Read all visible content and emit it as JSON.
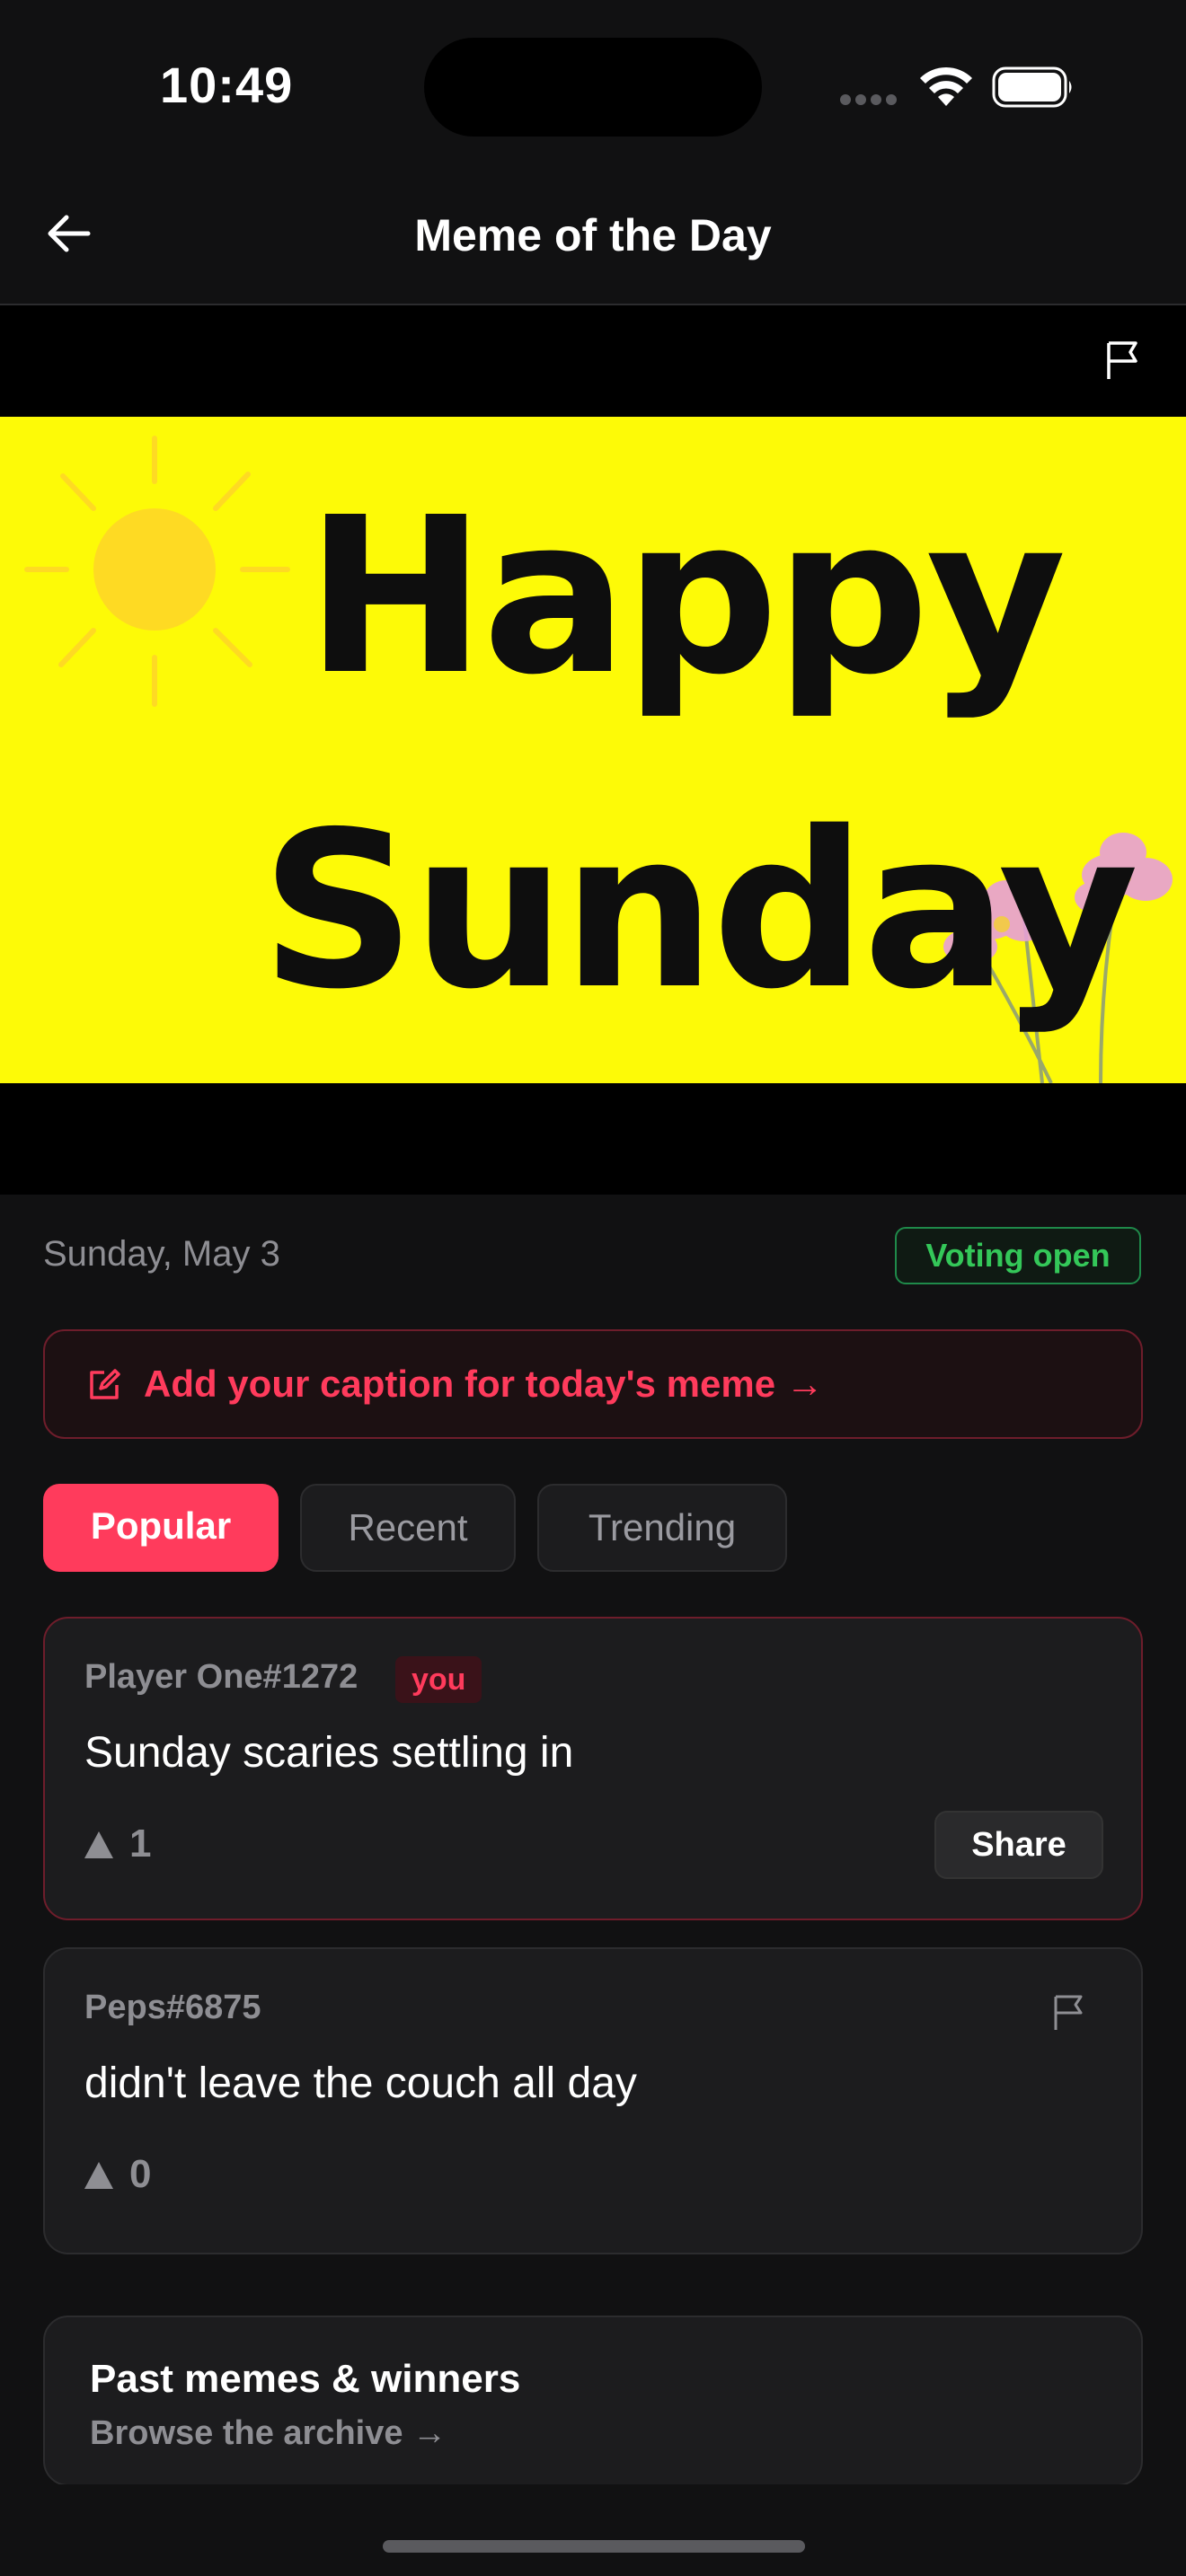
{
  "status_bar": {
    "time": "10:49"
  },
  "nav": {
    "title": "Meme of the Day",
    "back_icon": "arrow-left-icon"
  },
  "meme": {
    "line1": "Happy",
    "line2": "Sunday",
    "background_color": "#fdfa07",
    "flag_icon": "flag-icon"
  },
  "meta": {
    "date": "Sunday, May 3",
    "status": "Voting open",
    "status_color": "#34c759"
  },
  "cta": {
    "label": "Add your caption for today's meme →",
    "icon": "edit-icon",
    "accent": "#ff3b5c"
  },
  "tabs": [
    {
      "label": "Popular",
      "active": true
    },
    {
      "label": "Recent",
      "active": false
    },
    {
      "label": "Trending",
      "active": false
    }
  ],
  "captions": [
    {
      "author": "Player One#1272",
      "badge": "you",
      "text": "Sunday scaries settling in",
      "votes": "1",
      "action": "Share"
    },
    {
      "author": "Peps#6875",
      "text": "didn't leave the couch all day",
      "votes": "0",
      "action_icon": "flag-icon"
    }
  ],
  "archive": {
    "title": "Past memes & winners",
    "subtitle": "Browse the archive →"
  }
}
